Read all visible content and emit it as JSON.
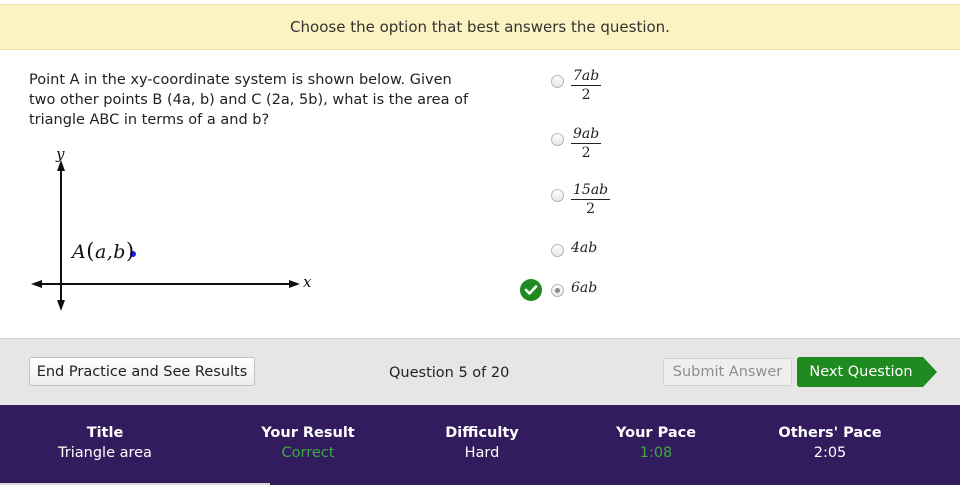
{
  "instruction": "Choose the option that best answers the question.",
  "question": {
    "text": "Point A in the xy-coordinate system is shown below. Given two other points B (4a, b) and C (2a, 5b), what is the area of triangle ABC in terms of a and b?",
    "figure": {
      "y_axis_label": "y",
      "x_axis_label": "x",
      "point_label_name": "A",
      "point_label_coords": "a,b",
      "point_color": "#1a1aff"
    }
  },
  "choices": [
    {
      "numerator": "7ab",
      "denominator": "2",
      "selected": false
    },
    {
      "numerator": "9ab",
      "denominator": "2",
      "selected": false
    },
    {
      "numerator": "15ab",
      "denominator": "2",
      "selected": false
    },
    {
      "text": "4ab",
      "selected": false
    },
    {
      "text": "6ab",
      "selected": true,
      "marked_correct": true
    }
  ],
  "controls": {
    "end_label": "End Practice and See Results",
    "counter": "Question 5 of 20",
    "submit_label": "Submit Answer",
    "next_label": "Next Question"
  },
  "stats": {
    "title_head": "Title",
    "title_val": "Triangle area",
    "result_head": "Your Result",
    "result_val": "Correct",
    "difficulty_head": "Difficulty",
    "difficulty_val": "Hard",
    "pace_head": "Your Pace",
    "pace_val": "1:08",
    "others_head": "Others' Pace",
    "others_val": "2:05"
  },
  "colors": {
    "instruction_bg": "#fdf3c2",
    "next_button": "#1f8a1f",
    "stats_bg": "#331c5e",
    "correct_text": "#3fa83f"
  }
}
